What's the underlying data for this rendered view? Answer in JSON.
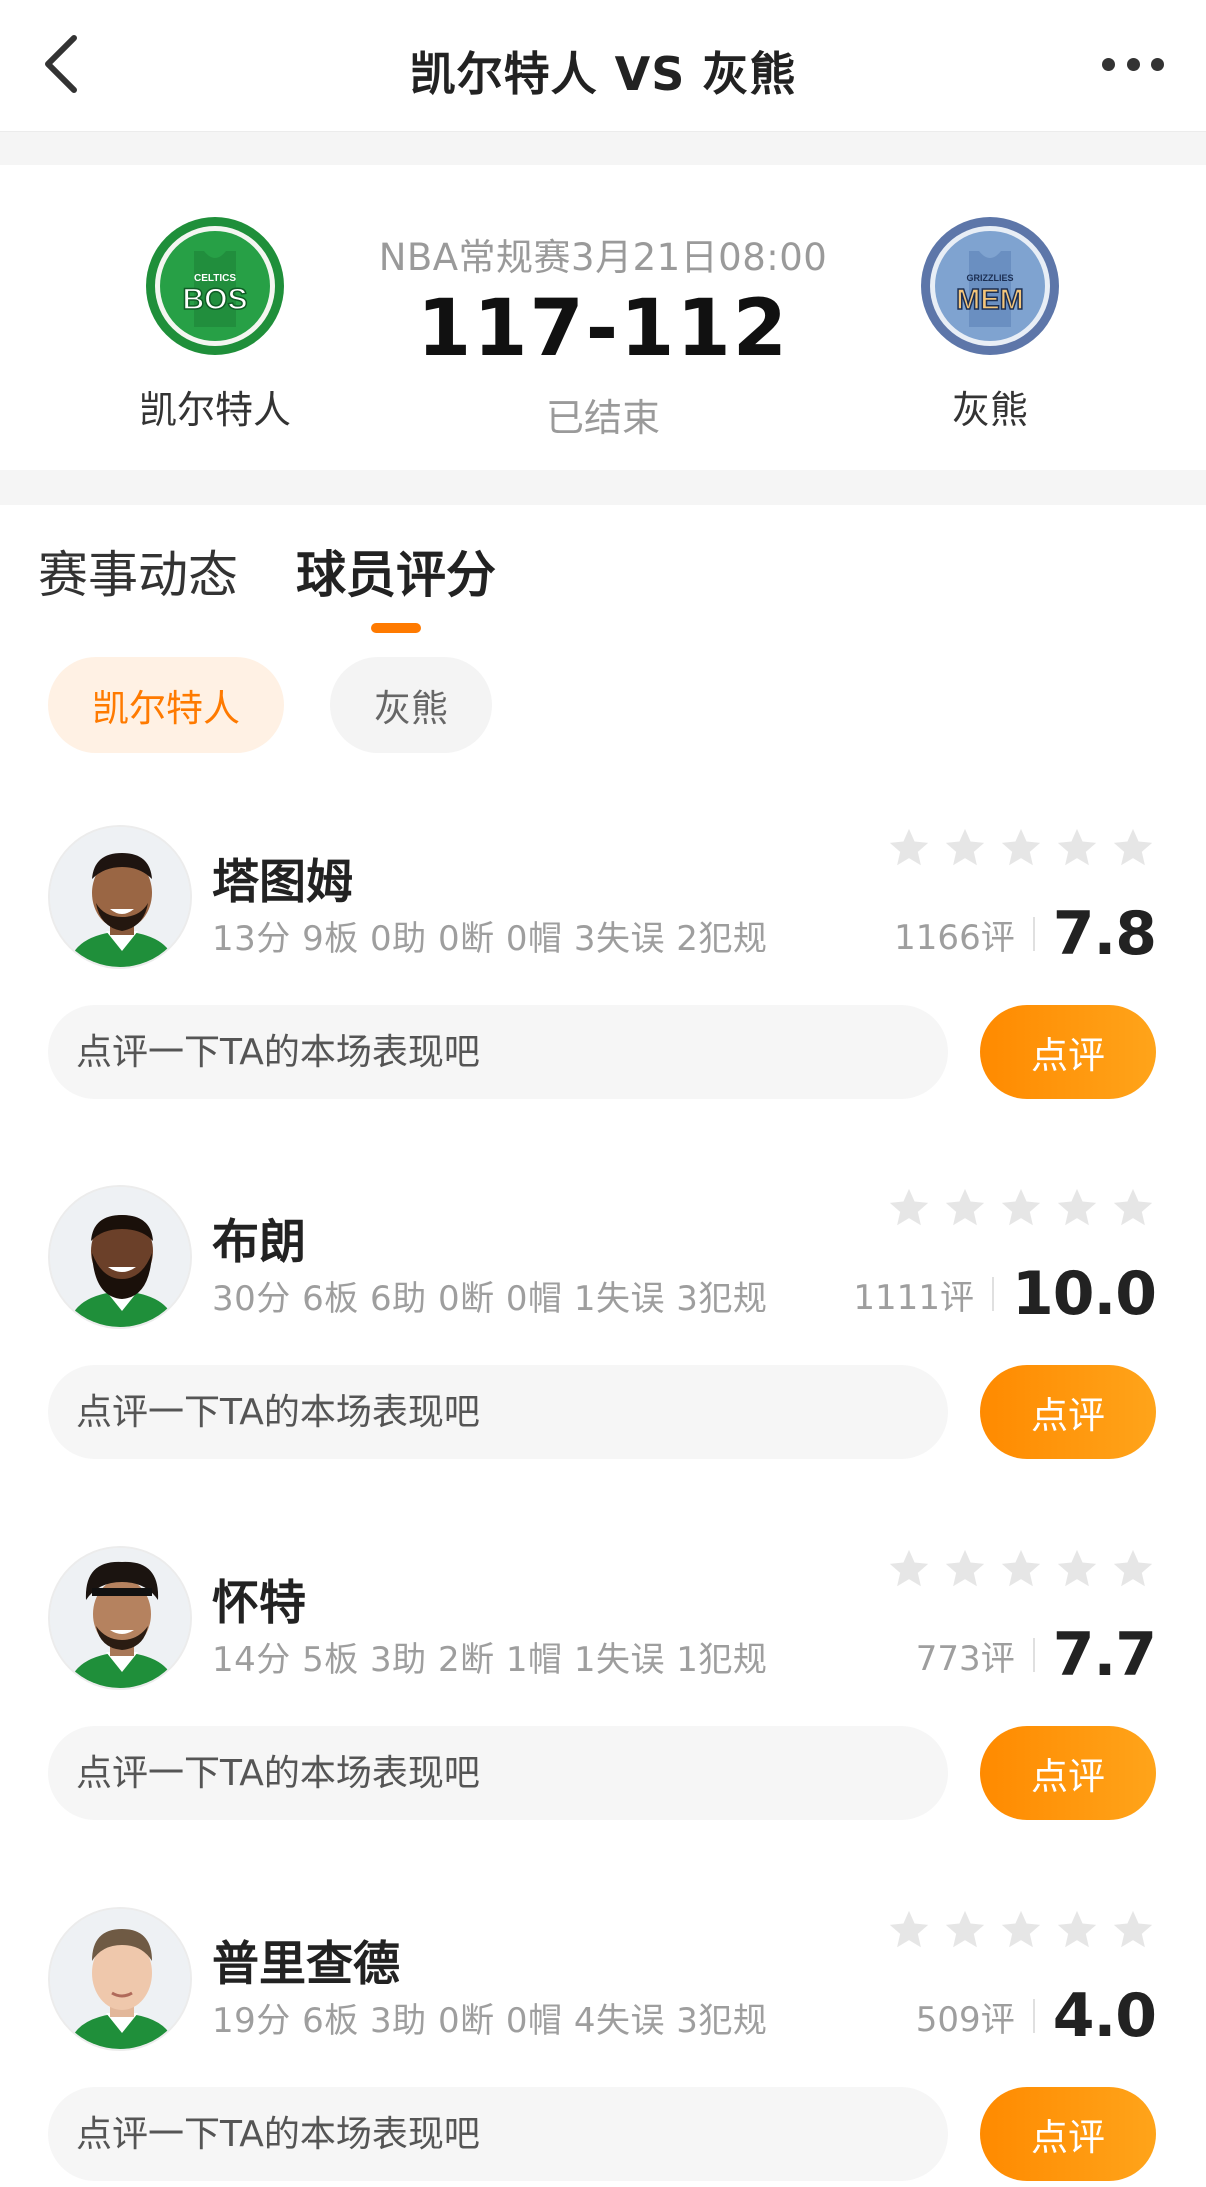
{
  "nav": {
    "title": "凯尔特人 VS 灰熊",
    "back_icon": "chevron-left-icon",
    "more_icon": "ellipsis-icon"
  },
  "match": {
    "home": {
      "name": "凯尔特人",
      "logo_text": "BOS",
      "logo_sub": "CELTICS",
      "color": "#1f8f3a"
    },
    "away": {
      "name": "灰熊",
      "logo_text": "MEM",
      "logo_sub": "GRIZZLIES",
      "color": "#5d76a9"
    },
    "meta": "NBA常规赛3月21日08:00",
    "score": "117-112",
    "status": "已结束"
  },
  "tabs": [
    {
      "label": "赛事动态",
      "active": false
    },
    {
      "label": "球员评分",
      "active": true
    }
  ],
  "team_filters": [
    {
      "label": "凯尔特人",
      "active": true
    },
    {
      "label": "灰熊",
      "active": false
    }
  ],
  "colors": {
    "accent": "#ff7a00",
    "star_empty": "#e6e6e6"
  },
  "players": [
    {
      "name": "塔图姆",
      "stats": "13分 9板 0助 0断 0帽 3失误 2犯规",
      "rating_count": "1166评",
      "score": "7.8",
      "comment_placeholder": "点评一下TA的本场表现吧",
      "button_label": "点评"
    },
    {
      "name": "布朗",
      "stats": "30分 6板 6助 0断 0帽 1失误 3犯规",
      "rating_count": "1111评",
      "score": "10.0",
      "comment_placeholder": "点评一下TA的本场表现吧",
      "button_label": "点评"
    },
    {
      "name": "怀特",
      "stats": "14分 5板 3助 2断 1帽 1失误 1犯规",
      "rating_count": "773评",
      "score": "7.7",
      "comment_placeholder": "点评一下TA的本场表现吧",
      "button_label": "点评"
    },
    {
      "name": "普里查德",
      "stats": "19分 6板 3助 0断 0帽 4失误 3犯规",
      "rating_count": "509评",
      "score": "4.0",
      "comment_placeholder": "点评一下TA的本场表现吧",
      "button_label": "点评"
    }
  ]
}
